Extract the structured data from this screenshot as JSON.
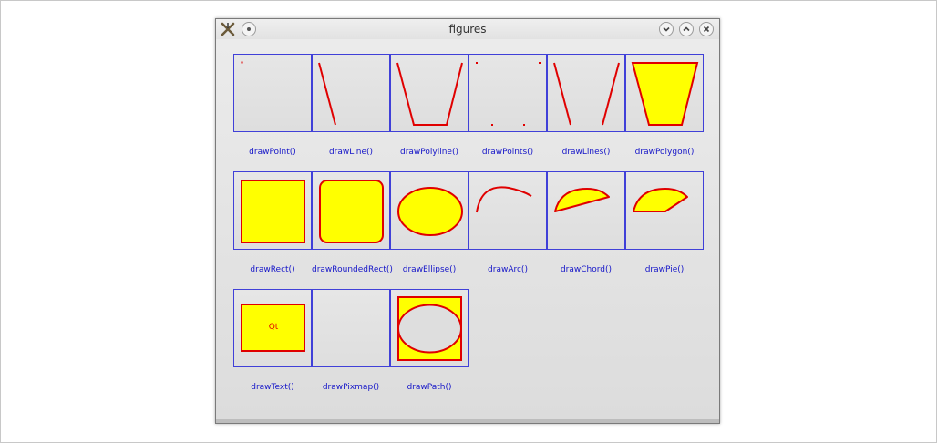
{
  "window": {
    "title": "figures",
    "icons": {
      "app": "app-icon",
      "pin": "pin-icon",
      "minimize": "minimize-icon",
      "maximize": "maximize-icon",
      "close": "close-icon"
    }
  },
  "colors": {
    "pen": "#e00000",
    "brush": "#ffff00",
    "frame": "#4040d8",
    "label": "#1515c8"
  },
  "figures": [
    {
      "name": "point",
      "label": "drawPoint()"
    },
    {
      "name": "line",
      "label": "drawLine()"
    },
    {
      "name": "polyline",
      "label": "drawPolyline()"
    },
    {
      "name": "points",
      "label": "drawPoints()"
    },
    {
      "name": "lines",
      "label": "drawLines()"
    },
    {
      "name": "polygon",
      "label": "drawPolygon()"
    },
    {
      "name": "rect",
      "label": "drawRect()"
    },
    {
      "name": "rounded-rect",
      "label": "drawRoundedRect()"
    },
    {
      "name": "ellipse",
      "label": "drawEllipse()"
    },
    {
      "name": "arc",
      "label": "drawArc()"
    },
    {
      "name": "chord",
      "label": "drawChord()"
    },
    {
      "name": "pie",
      "label": "drawPie()"
    },
    {
      "name": "text",
      "label": "drawText()",
      "text": "Qt"
    },
    {
      "name": "pixmap",
      "label": "drawPixmap()"
    },
    {
      "name": "path",
      "label": "drawPath()"
    }
  ]
}
